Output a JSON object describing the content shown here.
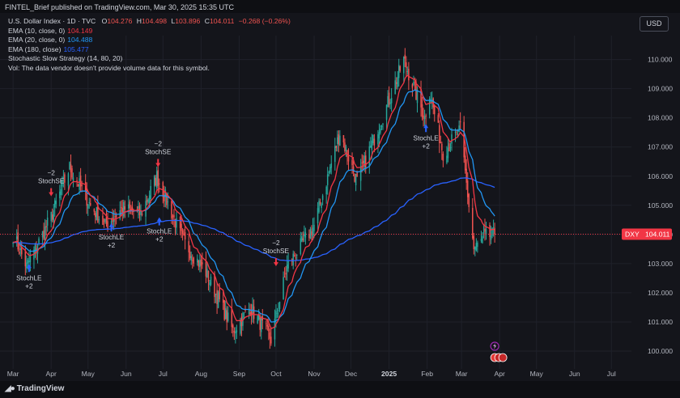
{
  "header": {
    "published": "FINTEL_Brief published on TradingView.com, Mar 30, 2025 15:35 UTC",
    "currency_button": "USD"
  },
  "legend": {
    "symbol_line": "U.S. Dollar Index · 1D · TVC",
    "ohlc": {
      "o_label": "O",
      "o": "104.276",
      "h_label": "H",
      "h": "104.498",
      "l_label": "L",
      "l": "103.896",
      "c_label": "C",
      "c": "104.011",
      "chg": "−0.268 (−0.26%)"
    },
    "ema10": {
      "label": "EMA (10, close, 0)",
      "value": "104.149",
      "color": "#f23645"
    },
    "ema20": {
      "label": "EMA (20, close, 0)",
      "value": "104.488",
      "color": "#2196f3"
    },
    "ema180": {
      "label": "EMA (180, close)",
      "value": "105.477",
      "color": "#2962ff"
    },
    "strategy": "Stochastic Slow Strategy (14, 80, 20)",
    "vol": "Vol: The data vendor doesn't provide volume data for this symbol."
  },
  "footer": {
    "brand": "TradingView"
  },
  "chart_data": {
    "type": "candlestick",
    "symbol_tag": "DXY",
    "last_price": "104.011",
    "y_ticks": [
      "110.000",
      "109.000",
      "108.000",
      "107.000",
      "106.000",
      "105.000",
      "104.000",
      "103.000",
      "102.000",
      "101.000",
      "100.000"
    ],
    "ylim": [
      99.5,
      110.6
    ],
    "x_ticks": [
      "Mar",
      "Apr",
      "May",
      "Jun",
      "Jul",
      "Aug",
      "Sep",
      "Oct",
      "Nov",
      "Dec",
      "2025",
      "Feb",
      "Mar",
      "Apr",
      "May",
      "Jun",
      "Jul"
    ],
    "price_path": [
      [
        "2024-03-01",
        104.0
      ],
      [
        "2024-03-12",
        102.9
      ],
      [
        "2024-04-01",
        104.6
      ],
      [
        "2024-04-16",
        106.3
      ],
      [
        "2024-05-03",
        105.0
      ],
      [
        "2024-05-15",
        104.3
      ],
      [
        "2024-05-29",
        104.9
      ],
      [
        "2024-06-13",
        104.7
      ],
      [
        "2024-06-26",
        106.0
      ],
      [
        "2024-07-17",
        103.8
      ],
      [
        "2024-08-05",
        102.7
      ],
      [
        "2024-08-27",
        100.7
      ],
      [
        "2024-09-10",
        101.5
      ],
      [
        "2024-09-27",
        100.4
      ],
      [
        "2024-10-10",
        102.9
      ],
      [
        "2024-11-01",
        104.3
      ],
      [
        "2024-11-22",
        107.5
      ],
      [
        "2024-12-06",
        105.8
      ],
      [
        "2024-12-31",
        108.5
      ],
      [
        "2025-01-13",
        110.0
      ],
      [
        "2025-01-30",
        108.0
      ],
      [
        "2025-02-03",
        108.9
      ],
      [
        "2025-02-14",
        106.8
      ],
      [
        "2025-02-28",
        107.6
      ],
      [
        "2025-03-11",
        103.5
      ],
      [
        "2025-03-20",
        103.9
      ],
      [
        "2025-03-28",
        104.0
      ]
    ],
    "series": [
      {
        "name": "EMA (10, close, 0)",
        "color": "#f23645"
      },
      {
        "name": "EMA (20, close, 0)",
        "color": "#2196f3"
      },
      {
        "name": "EMA (180, close)",
        "color": "#2962ff"
      }
    ],
    "signals": [
      {
        "date": "2024-03-14",
        "price": 103.1,
        "kind": "long",
        "label": "StochLE",
        "qty": "+2"
      },
      {
        "date": "2024-04-01",
        "price": 105.2,
        "kind": "short",
        "label": "StochSE",
        "qty": "−2"
      },
      {
        "date": "2024-05-20",
        "price": 104.5,
        "kind": "long",
        "label": "StochLE",
        "qty": "+2"
      },
      {
        "date": "2024-06-27",
        "price": 106.2,
        "kind": "short",
        "label": "StochSE",
        "qty": "−2"
      },
      {
        "date": "2024-06-28",
        "price": 104.7,
        "kind": "long",
        "label": "StochLE",
        "qty": "+2"
      },
      {
        "date": "2024-10-01",
        "price": 102.8,
        "kind": "short",
        "label": "StochSE",
        "qty": "−2"
      },
      {
        "date": "2025-01-31",
        "price": 107.9,
        "kind": "long",
        "label": "StochLE",
        "qty": "+2"
      }
    ],
    "grid": true,
    "legend_position": "top-left",
    "colors": {
      "up": "#26a69a",
      "down": "#ef5350",
      "background": "#14151b",
      "grid": "#1f212a",
      "price_line": "#f23645"
    }
  }
}
